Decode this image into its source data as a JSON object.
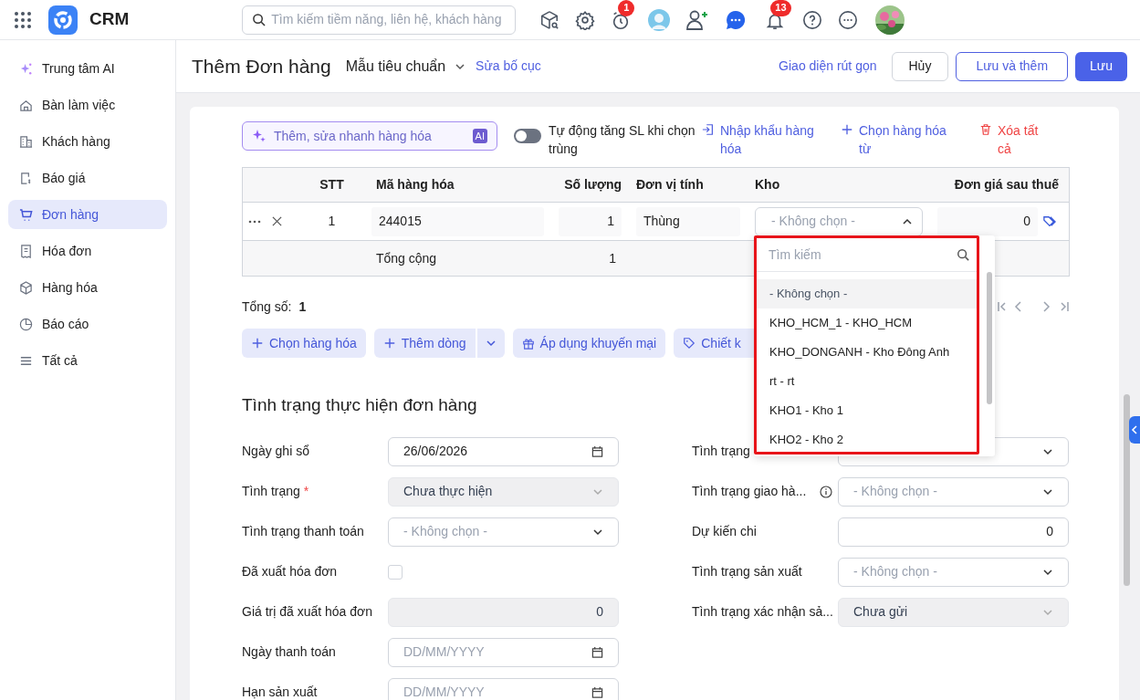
{
  "app": {
    "name": "CRM"
  },
  "search": {
    "placeholder": "Tìm kiếm tiềm năng, liên hệ, khách hàng"
  },
  "reminder_badge": "1",
  "notification_badge": "13",
  "sidebar": {
    "items": [
      {
        "label": "Trung tâm AI",
        "selected": false
      },
      {
        "label": "Bàn làm việc",
        "selected": false
      },
      {
        "label": "Khách hàng",
        "selected": false
      },
      {
        "label": "Báo giá",
        "selected": false
      },
      {
        "label": "Đơn hàng",
        "selected": true
      },
      {
        "label": "Hóa đơn",
        "selected": false
      },
      {
        "label": "Hàng hóa",
        "selected": false
      },
      {
        "label": "Báo cáo",
        "selected": false
      },
      {
        "label": "Tất cả",
        "selected": false
      }
    ]
  },
  "header": {
    "title": "Thêm Đơn hàng",
    "template": "Mẫu tiêu chuẩn",
    "edit_layout": "Sửa bố cục",
    "compact_view": "Giao diện rút gọn",
    "buttons": [
      {
        "label": "Hủy",
        "kind": "secondary"
      },
      {
        "label": "Lưu và thêm",
        "kind": "outline"
      },
      {
        "label": "Lưu",
        "kind": "primary"
      }
    ]
  },
  "products": {
    "quick_add": {
      "placeholder": "Thêm, sửa nhanh hàng hóa",
      "badge": "AI"
    },
    "auto_increase": {
      "label": "Tự động tăng SL khi chọn trùng",
      "on": false
    },
    "actions": [
      {
        "label": "Nhập khẩu hàng hóa",
        "kind": "import"
      },
      {
        "label": "Chọn hàng hóa từ",
        "kind": "add"
      },
      {
        "label": "Xóa tất cả",
        "kind": "delete"
      }
    ],
    "table": {
      "columns": [
        "STT",
        "Mã hàng hóa",
        "Số lượng",
        "Đơn vị tính",
        "Kho",
        "Đơn giá sau thuế"
      ],
      "rows": [
        {
          "stt": "1",
          "code": "244015",
          "quantity": "1",
          "unit": "Thùng",
          "warehouse": {
            "placeholder": "- Không chọn -",
            "expanded": true
          },
          "price": "0"
        }
      ],
      "total": {
        "label": "Tổng cộng",
        "quantity": "1"
      }
    },
    "total_count": {
      "label": "Tổng số:",
      "value": "1"
    },
    "buttons": [
      {
        "label": "Chọn hàng hóa",
        "kind": "add"
      },
      {
        "label": "Thêm dòng",
        "kind": "split"
      },
      {
        "label": "Áp dụng khuyến mại",
        "kind": "gift"
      },
      {
        "label": "Chiết k",
        "kind": "tag"
      }
    ]
  },
  "warehouse_dropdown": {
    "search_placeholder": "Tìm kiếm",
    "options": [
      {
        "label": "- Không chọn -",
        "selected": true
      },
      {
        "label": "KHO_HCM_1 - KHO_HCM",
        "selected": false
      },
      {
        "label": "KHO_DONGANH - Kho Đông Anh",
        "selected": false
      },
      {
        "label": "rt - rt",
        "selected": false
      },
      {
        "label": "KHO1 - Kho 1",
        "selected": false
      },
      {
        "label": "KHO2 - Kho 2",
        "selected": false
      }
    ]
  },
  "status_section": {
    "title": "Tình trạng thực hiện đơn hàng",
    "left_fields": [
      {
        "label": "Ngày ghi sổ",
        "kind": "date",
        "value": "26/06/2026"
      },
      {
        "label": "Tình trạng",
        "kind": "select",
        "required_mark": "*",
        "disabled": true,
        "value": "Chưa thực hiện"
      },
      {
        "label": "Tình trạng thanh toán",
        "kind": "select",
        "placeholder": "- Không chọn -"
      },
      {
        "label": "Đã xuất hóa đơn",
        "kind": "checkbox",
        "checked": false
      },
      {
        "label": "Giá trị đã xuất hóa đơn",
        "kind": "number",
        "disabled": true,
        "value": "0"
      },
      {
        "label": "Ngày thanh toán",
        "kind": "date",
        "placeholder": "DD/MM/YYYY"
      },
      {
        "label": "Hạn sản xuất",
        "kind": "date",
        "placeholder": "DD/MM/YYYY"
      }
    ],
    "right_fields": [
      {
        "label": "Tình trạng",
        "kind": "select"
      },
      {
        "label": "Tình trạng giao hà...",
        "kind": "select",
        "info": true,
        "placeholder": "- Không chọn -"
      },
      {
        "label": "Dự kiến chi",
        "kind": "number",
        "value": "0"
      },
      {
        "label": "Tình trạng sản xuất",
        "kind": "select",
        "placeholder": "- Không chọn -"
      },
      {
        "label": "Tình trạng xác nhận sả...",
        "kind": "select",
        "disabled": true,
        "value": "Chưa gửi"
      }
    ]
  }
}
